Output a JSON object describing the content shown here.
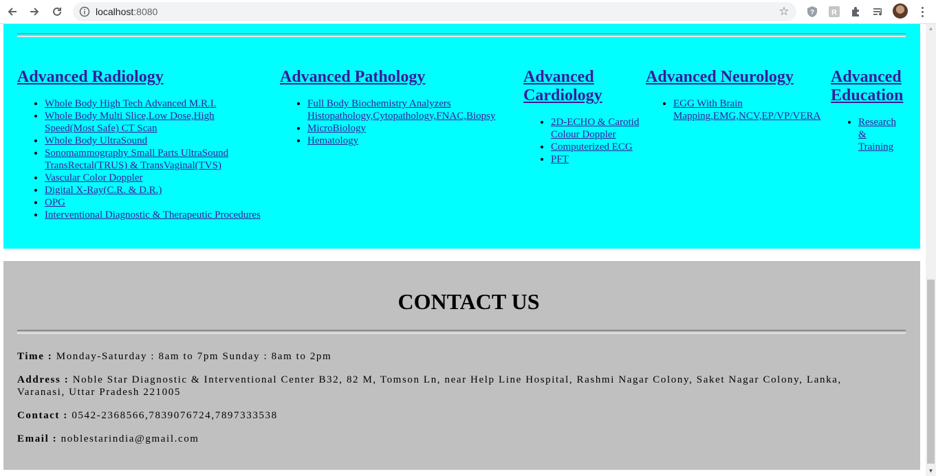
{
  "browser": {
    "url_host": "localhost",
    "url_port": ":8080"
  },
  "services": [
    {
      "heading": "Advanced Radiology",
      "items": [
        "Whole Body High Tech Advanced M.R.I.",
        "Whole Body Multi Slice,Low Dose,High Speed(Most Safe) CT Scan",
        "Whole Body UltraSound",
        "Sonomammography Small Parts UltraSound TransRectal(TRUS) & TransVaginal(TVS)",
        "Vascular Color Doppler",
        "Digital X-Ray(C.R. & D.R.)",
        "OPG",
        "Interventional Diagnostic & Therapeutic Procedures"
      ]
    },
    {
      "heading": "Advanced Pathology",
      "items": [
        "Full Body Biochemistry Analyzers Histopathology,Cytopathology,FNAC,Biopsy",
        "MicroBiology",
        "Hematology"
      ]
    },
    {
      "heading": "Advanced Cardiology",
      "items": [
        "2D-ECHO & Carotid Colour Doppler",
        "Computerized ECG",
        "PFT"
      ]
    },
    {
      "heading": "Advanced Neurology",
      "items": [
        "EGG With Brain Mapping,EMG,NCV,EP/VP/VERA"
      ]
    },
    {
      "heading": "Advanced Education",
      "items": [
        "Research & Training"
      ]
    }
  ],
  "contact": {
    "title": "CONTACT US",
    "time_label": "Time :",
    "time_value": "Monday-Saturday : 8am to 7pm Sunday : 8am to 2pm",
    "address_label": "Address :",
    "address_value": "Noble Star Diagnostic & Interventional Center B32, 82 M, Tomson Ln, near Help Line Hospital, Rashmi Nagar Colony, Saket Nagar Colony, Lanka, Varanasi, Uttar Pradesh 221005",
    "contact_label": "Contact :",
    "contact_value": "0542-2368566,7839076724,7897333538",
    "email_label": "Email :",
    "email_value": "noblestarindia@gmail.com"
  }
}
